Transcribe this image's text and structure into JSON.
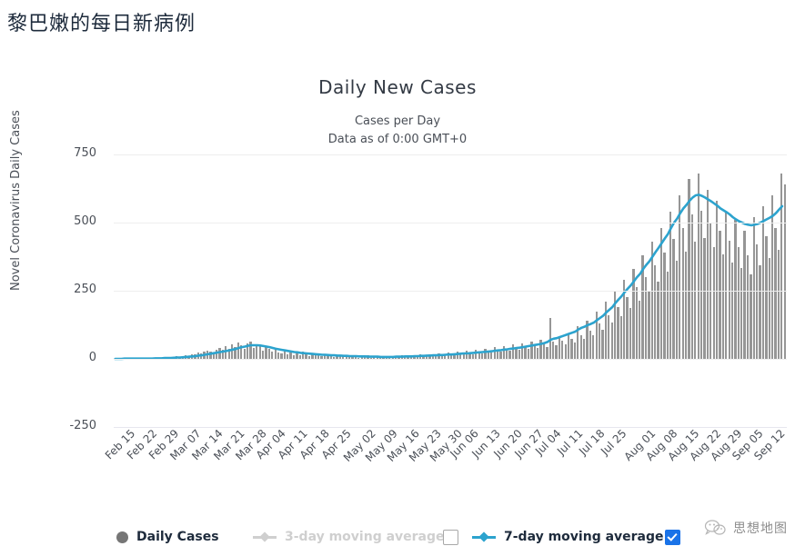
{
  "page": {
    "title": "黎巴嫩的每日新病例"
  },
  "chart": {
    "title": "Daily New Cases",
    "subtitle1": "Cases per Day",
    "subtitle2": "Data as of 0:00 GMT+0"
  },
  "legend": {
    "items": [
      {
        "label": "Daily Cases",
        "icon": "circle-marker",
        "state": "active",
        "color": "#767676"
      },
      {
        "label": "3-day moving average",
        "icon": "line-marker",
        "state": "disabled",
        "color": "#cfcfcf"
      },
      {
        "label": "7-day moving average",
        "icon": "line-marker",
        "state": "active",
        "color": "#2ca3ce"
      }
    ],
    "checkbox_unchecked_label": "",
    "checkbox_checked_label": ""
  },
  "watermark": {
    "text": "思想地图",
    "icon": "wechat-logo-icon"
  },
  "colors": {
    "bar": "#969696",
    "line": "#2ca3ce",
    "grid": "#eeeeee",
    "axis_text": "#4a4f57",
    "checkbox_accent": "#1a73e8"
  },
  "chart_data": {
    "type": "bar",
    "title": "Daily New Cases",
    "subtitle": "Cases per Day / Data as of 0:00 GMT+0",
    "xlabel": "",
    "ylabel": "Novel Coronavirus Daily Cases",
    "ylim": [
      -250,
      750
    ],
    "yticks": [
      750,
      500,
      250,
      0,
      -250
    ],
    "grid": true,
    "legend_position": "bottom",
    "xtick_labels": [
      "Feb 15",
      "Feb 22",
      "Feb 29",
      "Mar 07",
      "Mar 14",
      "Mar 21",
      "Mar 28",
      "Apr 04",
      "Apr 11",
      "Apr 18",
      "Apr 25",
      "May 02",
      "May 09",
      "May 16",
      "May 23",
      "May 30",
      "Jun 06",
      "Jun 13",
      "Jun 20",
      "Jun 27",
      "Jul 04",
      "Jul 11",
      "Jul 18",
      "Jul 25",
      "Aug 01",
      "Aug 08",
      "Aug 15",
      "Aug 22",
      "Aug 29",
      "Sep 05",
      "Sep 12"
    ],
    "x_start": "Feb 15",
    "x_end": "Sep 15",
    "series": [
      {
        "name": "Daily Cases",
        "type": "bar",
        "color": "#969696",
        "values": [
          0,
          0,
          0,
          1,
          0,
          0,
          2,
          0,
          1,
          0,
          2,
          0,
          3,
          1,
          0,
          4,
          2,
          6,
          3,
          5,
          9,
          7,
          11,
          14,
          10,
          18,
          16,
          22,
          19,
          26,
          31,
          28,
          24,
          35,
          41,
          33,
          46,
          38,
          52,
          44,
          60,
          49,
          38,
          57,
          63,
          41,
          52,
          48,
          30,
          44,
          36,
          28,
          33,
          25,
          20,
          31,
          18,
          22,
          15,
          19,
          12,
          26,
          16,
          10,
          21,
          13,
          17,
          9,
          14,
          11,
          18,
          7,
          12,
          9,
          15,
          6,
          10,
          8,
          13,
          5,
          9,
          7,
          12,
          4,
          8,
          6,
          11,
          3,
          7,
          5,
          10,
          8,
          6,
          12,
          9,
          7,
          14,
          10,
          8,
          16,
          11,
          9,
          18,
          13,
          10,
          20,
          15,
          12,
          22,
          17,
          14,
          26,
          19,
          16,
          30,
          23,
          18,
          34,
          26,
          21,
          38,
          29,
          24,
          42,
          33,
          27,
          47,
          36,
          30,
          52,
          40,
          33,
          58,
          45,
          37,
          64,
          49,
          41,
          71,
          55,
          45,
          150,
          62,
          50,
          80,
          66,
          54,
          95,
          74,
          60,
          120,
          88,
          72,
          140,
          105,
          86,
          175,
          130,
          108,
          210,
          160,
          132,
          250,
          190,
          158,
          290,
          228,
          186,
          330,
          265,
          215,
          380,
          300,
          248,
          430,
          345,
          285,
          480,
          390,
          320,
          540,
          440,
          360,
          600,
          480,
          395,
          660,
          530,
          430,
          680,
          545,
          445,
          620,
          500,
          410,
          580,
          470,
          385,
          540,
          435,
          355,
          510,
          410,
          335,
          470,
          380,
          310,
          520,
          420,
          345,
          560,
          450,
          370,
          600,
          480,
          400,
          680,
          640
        ]
      },
      {
        "name": "7-day moving average",
        "type": "line",
        "color": "#2ca3ce",
        "values": [
          0,
          0,
          0,
          1,
          1,
          1,
          1,
          1,
          1,
          1,
          1,
          1,
          1,
          2,
          2,
          2,
          3,
          3,
          3,
          4,
          5,
          5,
          6,
          7,
          8,
          9,
          10,
          12,
          13,
          15,
          17,
          19,
          21,
          23,
          25,
          27,
          29,
          31,
          34,
          36,
          40,
          43,
          45,
          48,
          50,
          50,
          50,
          49,
          47,
          45,
          43,
          40,
          37,
          35,
          33,
          31,
          29,
          27,
          25,
          24,
          22,
          21,
          20,
          19,
          18,
          17,
          16,
          15,
          15,
          14,
          13,
          13,
          12,
          12,
          11,
          11,
          10,
          10,
          10,
          9,
          9,
          9,
          8,
          8,
          8,
          8,
          7,
          7,
          7,
          7,
          7,
          8,
          8,
          8,
          9,
          9,
          9,
          10,
          10,
          11,
          11,
          12,
          12,
          13,
          13,
          14,
          14,
          15,
          16,
          16,
          17,
          18,
          19,
          20,
          20,
          21,
          22,
          23,
          24,
          25,
          26,
          27,
          28,
          30,
          31,
          32,
          34,
          35,
          37,
          38,
          40,
          41,
          43,
          45,
          47,
          49,
          51,
          53,
          55,
          58,
          62,
          70,
          74,
          76,
          80,
          84,
          88,
          92,
          96,
          100,
          108,
          114,
          118,
          124,
          128,
          133,
          142,
          150,
          158,
          170,
          180,
          190,
          205,
          218,
          230,
          245,
          258,
          270,
          285,
          300,
          312,
          330,
          345,
          358,
          375,
          392,
          408,
          425,
          442,
          458,
          480,
          500,
          515,
          535,
          552,
          565,
          580,
          592,
          600,
          602,
          598,
          592,
          585,
          578,
          570,
          562,
          552,
          545,
          538,
          530,
          520,
          512,
          505,
          500,
          495,
          492,
          490,
          492,
          495,
          500,
          506,
          512,
          518,
          525,
          535,
          548,
          560
        ]
      }
    ]
  }
}
